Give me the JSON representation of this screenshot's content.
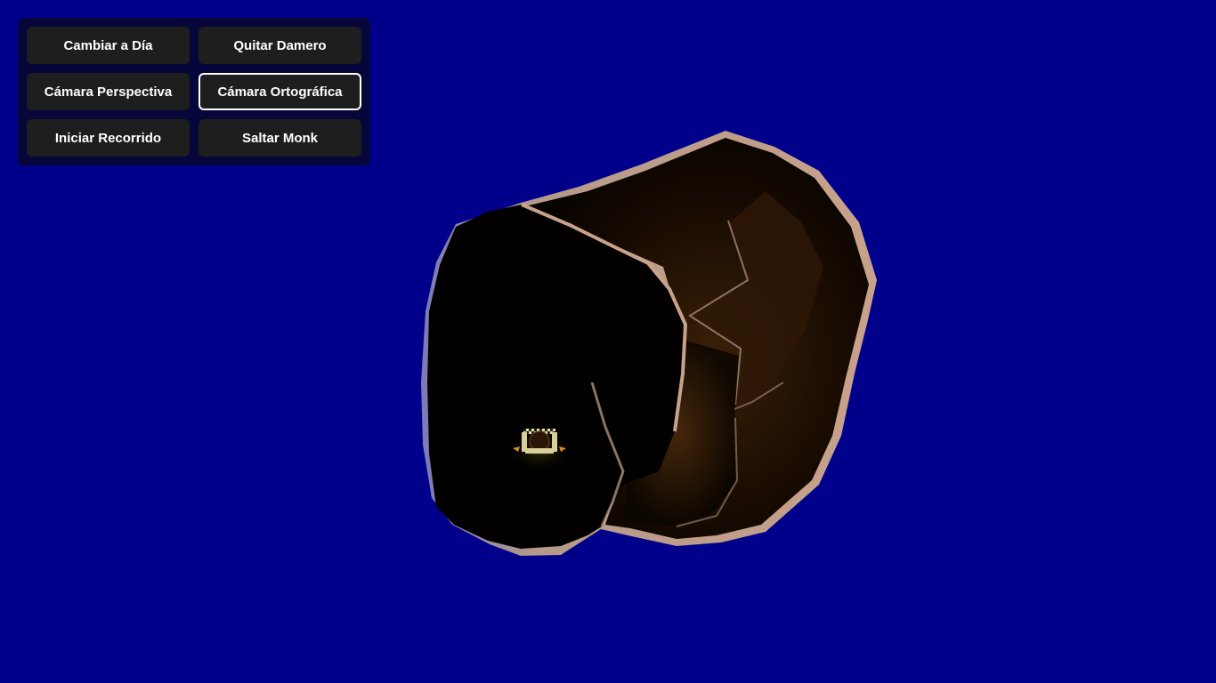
{
  "scene": {
    "background_color": "#00008b",
    "object": "dark-cave-tunnel",
    "character": "monk"
  },
  "controls": {
    "buttons": [
      {
        "id": "toggle-day",
        "label": "Cambiar a Día",
        "active": false
      },
      {
        "id": "toggle-checker",
        "label": "Quitar Damero",
        "active": false
      },
      {
        "id": "perspective-camera",
        "label": "Cámara Perspectiva",
        "active": false
      },
      {
        "id": "orthographic-camera",
        "label": "Cámara Ortográfica",
        "active": true
      },
      {
        "id": "start-tour",
        "label": "Iniciar Recorrido",
        "active": false
      },
      {
        "id": "jump-monk",
        "label": "Saltar Monk",
        "active": false
      }
    ]
  }
}
